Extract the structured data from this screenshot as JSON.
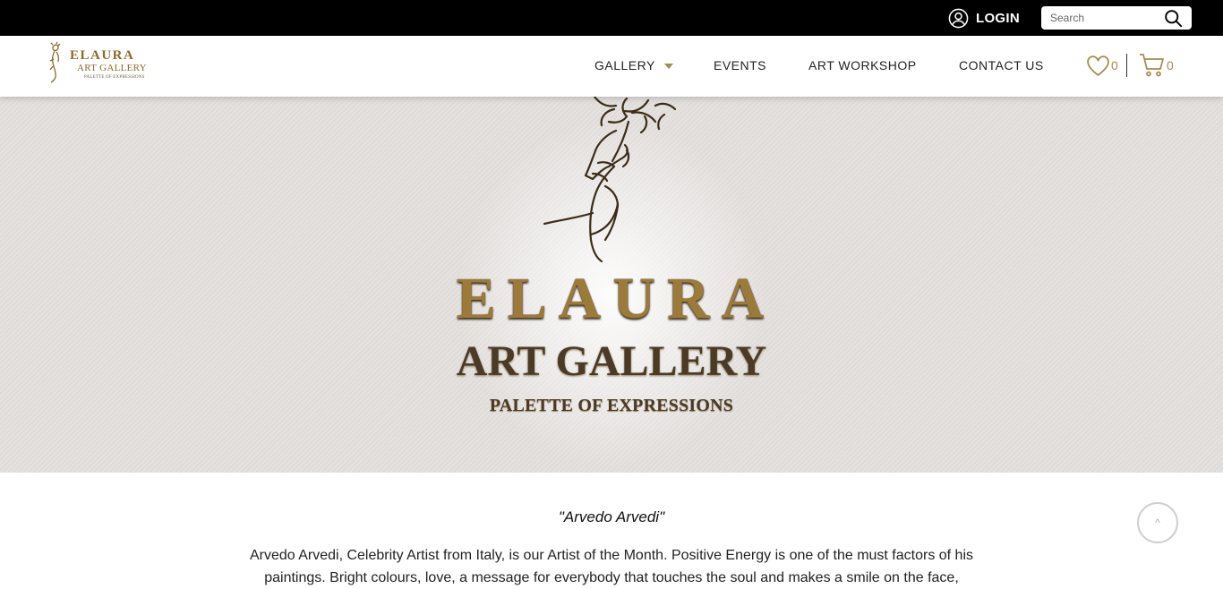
{
  "topbar": {
    "login_label": "LOGIN",
    "login_icon": "user-circle-icon",
    "search": {
      "placeholder": "Search",
      "icon": "search-icon"
    }
  },
  "brand": {
    "name": "ELAURA",
    "subtitle": "ART GALLERY",
    "tagline": "PALETTE OF EXPRESSIONS",
    "gold_color": "#9c7a3a"
  },
  "nav": {
    "items": [
      {
        "label": "GALLERY",
        "has_dropdown": true
      },
      {
        "label": "EVENTS"
      },
      {
        "label": "ART WORKSHOP"
      },
      {
        "label": "CONTACT US"
      }
    ],
    "wishlist": {
      "icon": "heart-icon",
      "count": "0"
    },
    "cart": {
      "icon": "cart-icon",
      "count": "0"
    }
  },
  "hero": {
    "title": "ELAURA",
    "subtitle": "ART GALLERY",
    "tagline": "PALETTE OF EXPRESSIONS"
  },
  "artist": {
    "name": "\"Arvedo Arvedi\"",
    "description": "Arvedo Arvedi, Celebrity Artist from Italy, is our Artist of the Month. Positive Energy is one of the must factors of his paintings. Bright colours, love, a message for everybody that touches the soul and makes a smile on the face,"
  },
  "scroll_top": {
    "icon": "chevron-up-icon",
    "glyph": "^"
  }
}
